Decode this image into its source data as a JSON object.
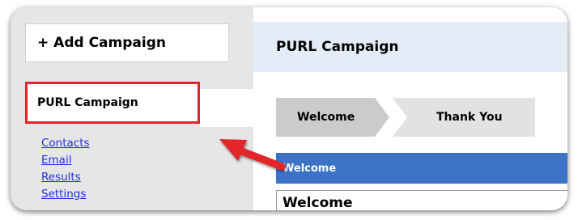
{
  "sidebar": {
    "add_button": "+ Add Campaign",
    "active_campaign": "PURL Campaign",
    "links": [
      "Contacts",
      "Email",
      "Results",
      "Settings"
    ]
  },
  "main": {
    "header_title": "PURL Campaign",
    "steps": [
      "Welcome",
      "Thank You"
    ],
    "section_title": "Welcome",
    "title_field_value": "Welcome"
  },
  "annotation": {
    "arrow_color": "#e2252b",
    "highlight_color": "#e2252b"
  },
  "colors": {
    "section_bar": "#3d73c6",
    "header_bg": "#e4ecf7",
    "link": "#1f2fd6"
  }
}
